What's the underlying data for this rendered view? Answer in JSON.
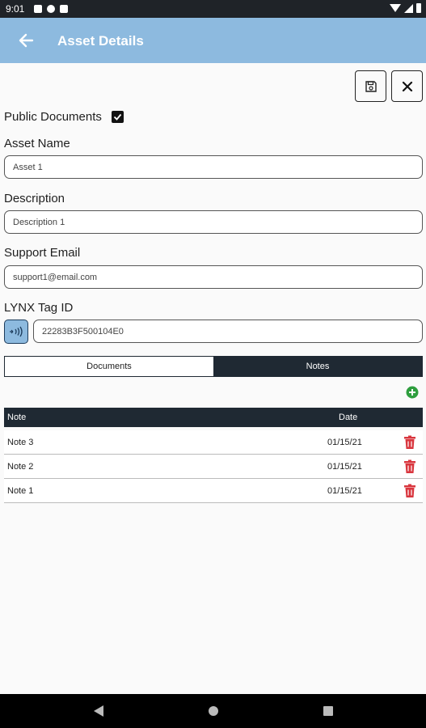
{
  "status_bar": {
    "time": "9:01"
  },
  "app_bar": {
    "title": "Asset Details"
  },
  "actions": {
    "save_icon": "save-icon",
    "close_icon": "close-icon"
  },
  "form": {
    "public_documents": {
      "label": "Public Documents",
      "checked": true
    },
    "asset_name": {
      "label": "Asset Name",
      "value": "Asset 1"
    },
    "description": {
      "label": "Description",
      "value": "Description 1"
    },
    "support_email": {
      "label": "Support Email",
      "value": "support1@email.com"
    },
    "lynx_tag": {
      "label": "LYNX Tag ID",
      "value": "22283B3F500104E0"
    }
  },
  "tabs": [
    {
      "label": "Documents",
      "active": false
    },
    {
      "label": "Notes",
      "active": true
    }
  ],
  "notes_table": {
    "columns": [
      "Note",
      "Date"
    ],
    "rows": [
      {
        "note": "Note 3",
        "date": "01/15/21"
      },
      {
        "note": "Note 2",
        "date": "01/15/21"
      },
      {
        "note": "Note 1",
        "date": "01/15/21"
      }
    ]
  },
  "colors": {
    "app_bar": "#8dbadf",
    "dark": "#1f2933",
    "add": "#2e9e3e",
    "delete": "#d9363e"
  }
}
